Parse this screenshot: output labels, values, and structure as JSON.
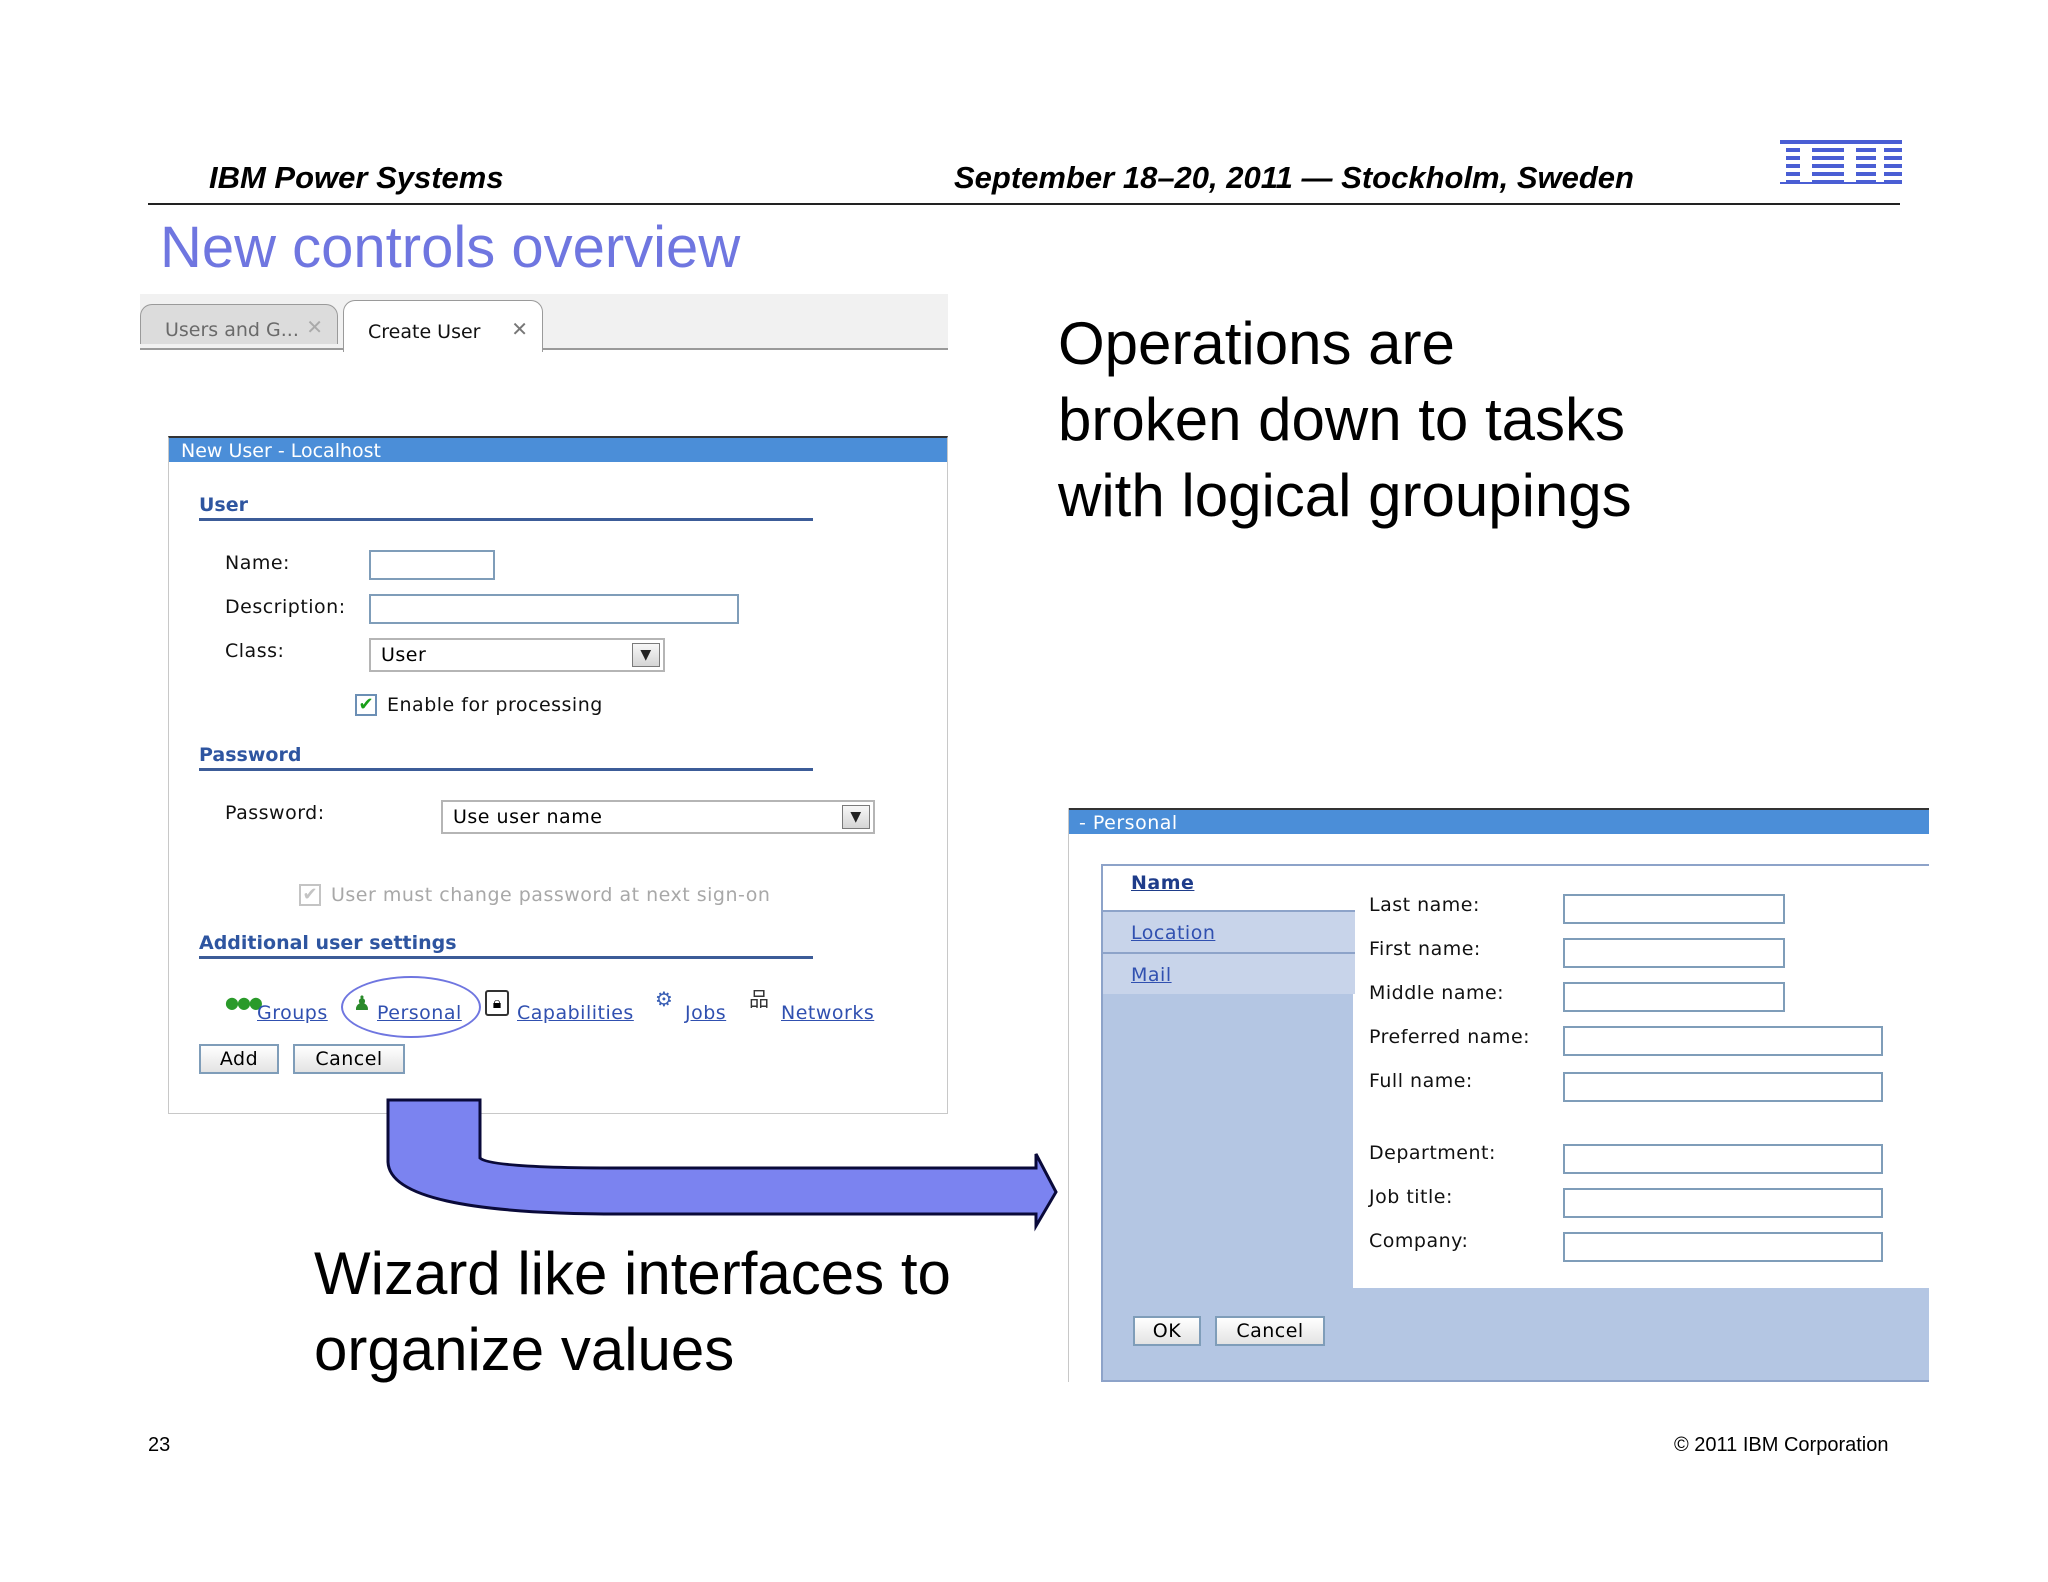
{
  "header": {
    "left": "IBM Power Systems",
    "right": "September 18–20, 2011 — Stockholm, Sweden",
    "logo_text": "IBM"
  },
  "slide": {
    "title": "New controls overview",
    "callout_top": [
      "Operations are",
      "broken down to tasks",
      "with logical groupings"
    ],
    "callout_bottom": [
      "Wizard like interfaces to",
      "organize values"
    ],
    "page_number": "23",
    "copyright": "© 2011 IBM Corporation"
  },
  "tabs": [
    {
      "label": "Users and G...",
      "close": "✕"
    },
    {
      "label": "Create User",
      "close": "✕"
    }
  ],
  "new_user_dialog": {
    "title": "New User - Localhost",
    "sections": {
      "user": "User",
      "password": "Password",
      "additional": "Additional user settings"
    },
    "fields": {
      "name_label": "Name:",
      "name_value": "",
      "description_label": "Description:",
      "description_value": "",
      "class_label": "Class:",
      "class_value": "User",
      "enable_label": "Enable for processing",
      "enable_checked": true,
      "password_label": "Password:",
      "password_value": "Use user name",
      "must_change_label": "User must change password at next sign-on",
      "must_change_checked": true
    },
    "settings_links": [
      "Groups",
      "Personal",
      "Capabilities",
      "Jobs",
      "Networks"
    ],
    "buttons": {
      "add": "Add",
      "cancel": "Cancel"
    }
  },
  "personal_dialog": {
    "title": "- Personal",
    "nav": [
      "Name",
      "Location",
      "Mail"
    ],
    "fields": [
      {
        "label": "Last name:",
        "value": ""
      },
      {
        "label": "First name:",
        "value": ""
      },
      {
        "label": "Middle name:",
        "value": ""
      },
      {
        "label": "Preferred name:",
        "value": ""
      },
      {
        "label": "Full name:",
        "value": ""
      },
      {
        "label": "Department:",
        "value": ""
      },
      {
        "label": "Job title:",
        "value": ""
      },
      {
        "label": "Company:",
        "value": ""
      }
    ],
    "buttons": {
      "ok": "OK",
      "cancel": "Cancel"
    }
  },
  "colors": {
    "title_blue": "#6f76e0",
    "dialog_bar": "#4b8ed8",
    "panel_blue": "#b4c6e3",
    "arrow_fill": "#7b83f0"
  },
  "icons": {
    "groups": "groups-icon",
    "personal": "person-icon",
    "capabilities": "lock-icon",
    "jobs": "gears-icon",
    "networks": "network-icon"
  }
}
